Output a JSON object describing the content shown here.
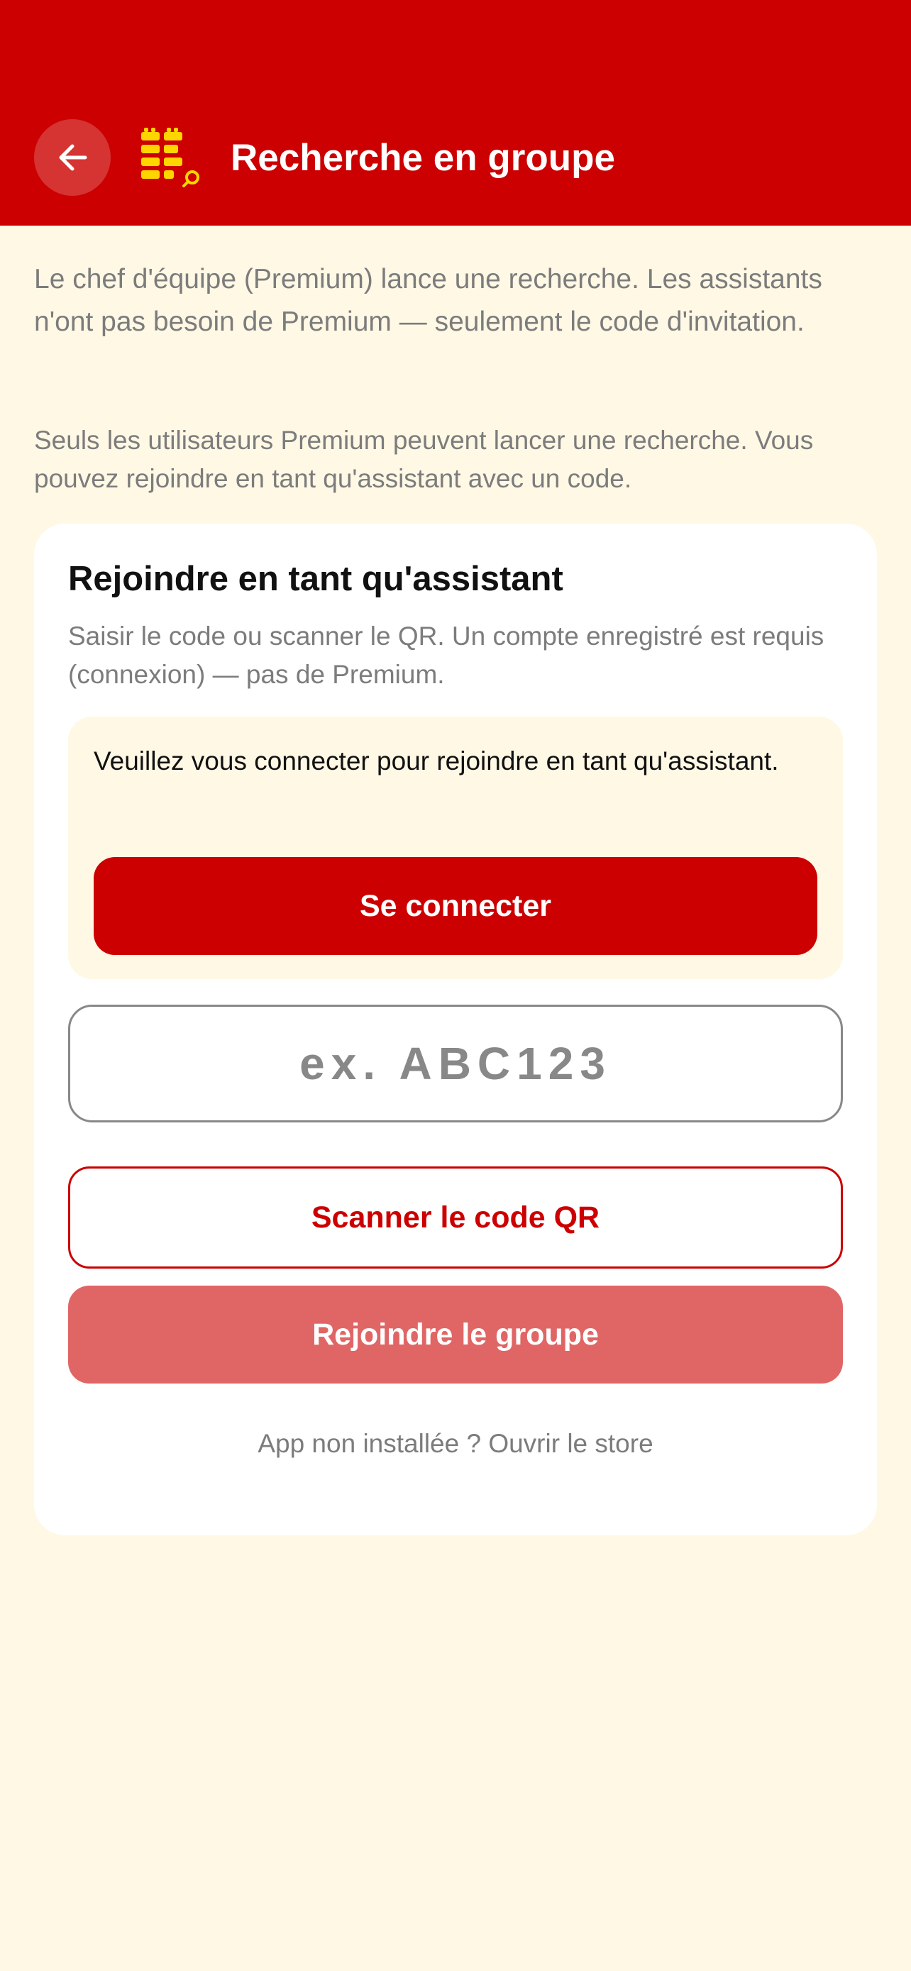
{
  "header": {
    "title": "Recherche en groupe",
    "background_color": "#cc0000",
    "back_icon": "arrow-left-icon",
    "logo_icon": "brick-search-logo-icon"
  },
  "intro": {
    "text": "Le chef d'équipe (Premium) lance une recherche. Les assistants n'ont pas besoin de Premium — seulement le code d'invitation.",
    "notice": "Seuls les utilisateurs Premium peuvent lancer une recherche. Vous pouvez rejoindre en tant qu'assistant avec un code."
  },
  "join_card": {
    "title": "Rejoindre en tant qu'assistant",
    "subtitle": "Saisir le code ou scanner le QR. Un compte enregistré est requis (connexion) — pas de Premium.",
    "login_prompt": "Veuillez vous connecter pour rejoindre en tant qu'assistant.",
    "login_button": "Se connecter",
    "code_input": {
      "value": "",
      "placeholder": "ex. ABC123"
    },
    "scan_button": "Scanner le code QR",
    "join_button": "Rejoindre le groupe",
    "store_link": "App non installée ? Ouvrir le store"
  },
  "colors": {
    "primary": "#cc0000",
    "primary_disabled": "#e06666",
    "background": "#fff8e5",
    "card": "#ffffff",
    "muted_text": "#7c7c7c",
    "logo_yellow": "#ffd500"
  }
}
